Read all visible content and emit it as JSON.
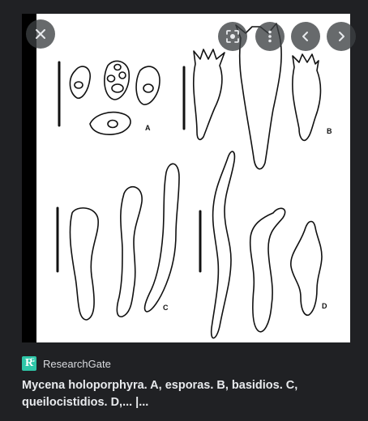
{
  "viewer": {
    "close_label": "Close",
    "lens_label": "Search inside image",
    "more_label": "More options",
    "prev_label": "Previous",
    "next_label": "Next"
  },
  "figure_labels": {
    "a": "A",
    "b": "B",
    "c": "C",
    "d": "D"
  },
  "source": {
    "name": "ResearchGate",
    "logo_text": "R"
  },
  "result": {
    "title": "Mycena holoporphyra. A, esporas. B, basidios. C, queilocistidios. D,... |..."
  },
  "colors": {
    "background": "#202124",
    "accent_logo": "#2fc6a8",
    "text": "#e8eaed"
  }
}
